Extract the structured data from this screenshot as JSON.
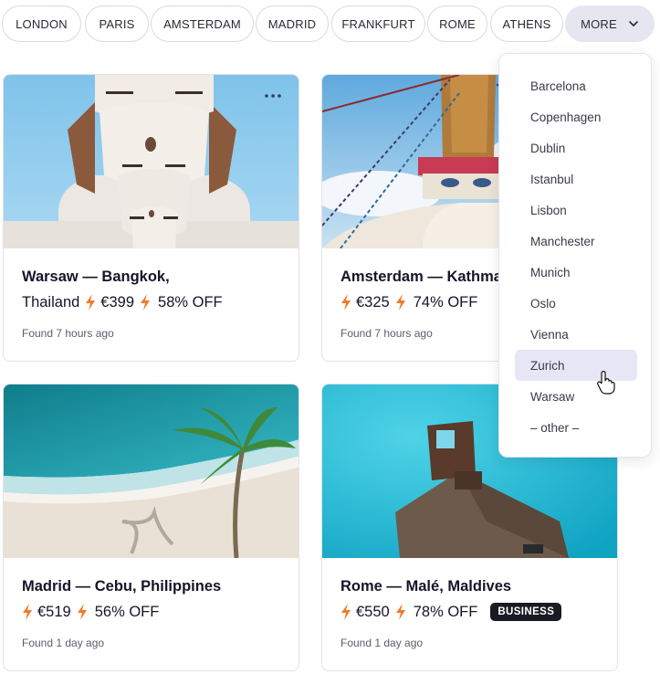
{
  "filters": {
    "cities": [
      "LONDON",
      "PARIS",
      "AMSTERDAM",
      "MADRID",
      "FRANKFURT",
      "ROME",
      "ATHENS"
    ],
    "more_label": "MORE"
  },
  "dropdown": {
    "items": [
      "Barcelona",
      "Copenhagen",
      "Dublin",
      "Istanbul",
      "Lisbon",
      "Manchester",
      "Munich",
      "Oslo",
      "Vienna",
      "Zurich",
      "Warsaw",
      "– other –"
    ],
    "highlighted": "Zurich"
  },
  "deals": [
    {
      "title": "Warsaw — Bangkok,",
      "destination_cont": "Thailand",
      "price": "€399",
      "discount": "58% OFF",
      "found": "Found 7 hours ago",
      "badge": ""
    },
    {
      "title": "Amsterdam — Kathmandu, Nepal",
      "destination_cont": "",
      "price": "€325",
      "discount": "74% OFF",
      "found": "Found 7 hours ago",
      "badge": ""
    },
    {
      "title": "Madrid — Cebu, Philippines",
      "destination_cont": "",
      "price": "€519",
      "discount": "56% OFF",
      "found": "Found 1 day ago",
      "badge": ""
    },
    {
      "title": "Rome — Malé, Maldives",
      "destination_cont": "",
      "price": "€550",
      "discount": "78% OFF",
      "found": "Found 1 day ago",
      "badge": "BUSINESS"
    }
  ],
  "colors": {
    "accent_bolt": "#f07a2a",
    "highlight": "#e7e6f7",
    "badge_bg": "#1a1a24"
  },
  "icons": {
    "bolt": "lightning-bolt-icon",
    "more": "chevron-down-icon",
    "menu": "more-dots-icon",
    "cursor": "hand-cursor-icon"
  }
}
